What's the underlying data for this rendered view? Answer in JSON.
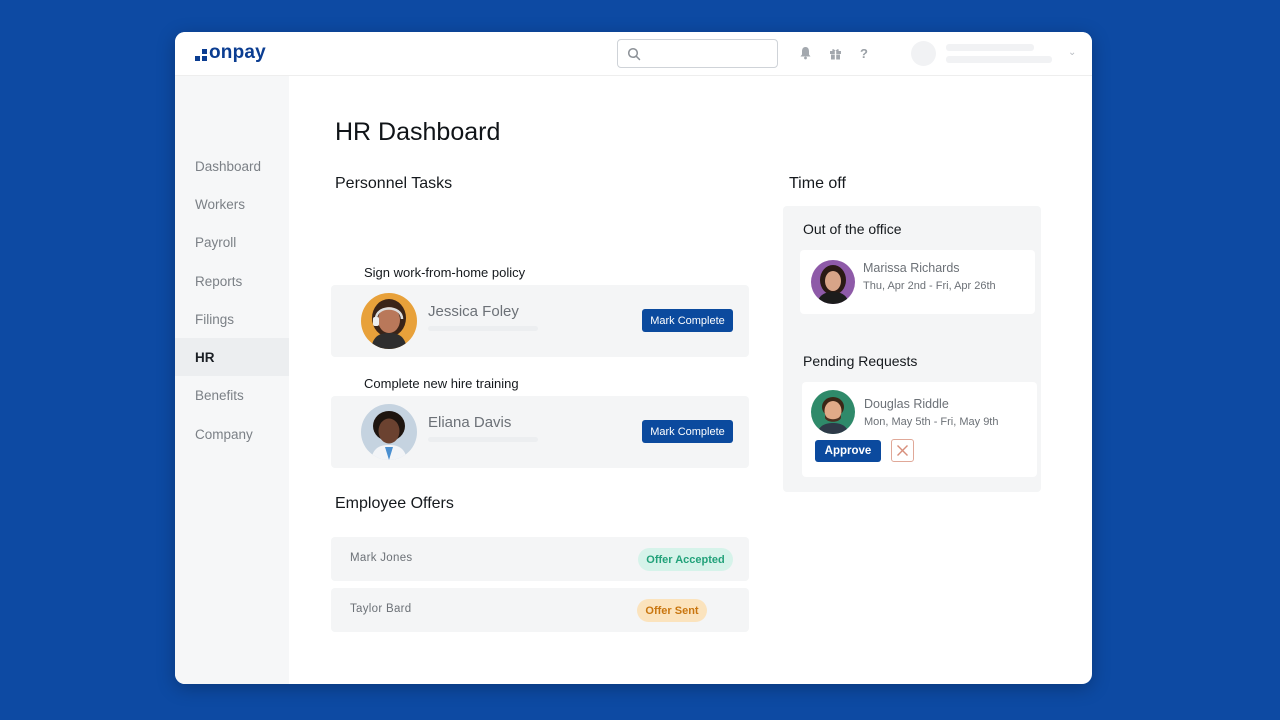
{
  "app": {
    "logo_text": "onpay",
    "brand_color": "#0b3d91",
    "background_color": "#0d4aa3"
  },
  "header": {
    "search_placeholder": "",
    "icons": [
      "bell-icon",
      "gift-icon",
      "help-icon"
    ],
    "help_glyph": "?",
    "caret_glyph": "⌄"
  },
  "sidebar": {
    "items": [
      {
        "label": "Dashboard",
        "active": false
      },
      {
        "label": "Workers",
        "active": false
      },
      {
        "label": "Payroll",
        "active": false
      },
      {
        "label": "Reports",
        "active": false
      },
      {
        "label": "Filings",
        "active": false
      },
      {
        "label": "HR",
        "active": true
      },
      {
        "label": "Benefits",
        "active": false
      },
      {
        "label": "Company",
        "active": false
      }
    ]
  },
  "main": {
    "title": "HR Dashboard",
    "personnel": {
      "title": "Personnel Tasks",
      "tasks": [
        {
          "label": "Sign work-from-home policy",
          "name": "Jessica Foley",
          "button": "Mark Complete"
        },
        {
          "label": "Complete new hire training",
          "name": "Eliana Davis",
          "button": "Mark Complete"
        }
      ]
    },
    "offers": {
      "title": "Employee Offers",
      "rows": [
        {
          "name": "Mark Jones",
          "status": "Offer Accepted",
          "status_color": "#22a27a"
        },
        {
          "name": "Taylor Bard",
          "status": "Offer Sent",
          "status_color": "#c9760f"
        }
      ]
    }
  },
  "time_off": {
    "title": "Time off",
    "out_of_office": {
      "title": "Out of the office",
      "name": "Marissa Richards",
      "dates": "Thu, Apr 2nd - Fri, Apr 26th"
    },
    "pending": {
      "title": "Pending Requests",
      "name": "Douglas Riddle",
      "dates": "Mon, May 5th - Fri, May 9th",
      "approve_label": "Approve"
    }
  }
}
